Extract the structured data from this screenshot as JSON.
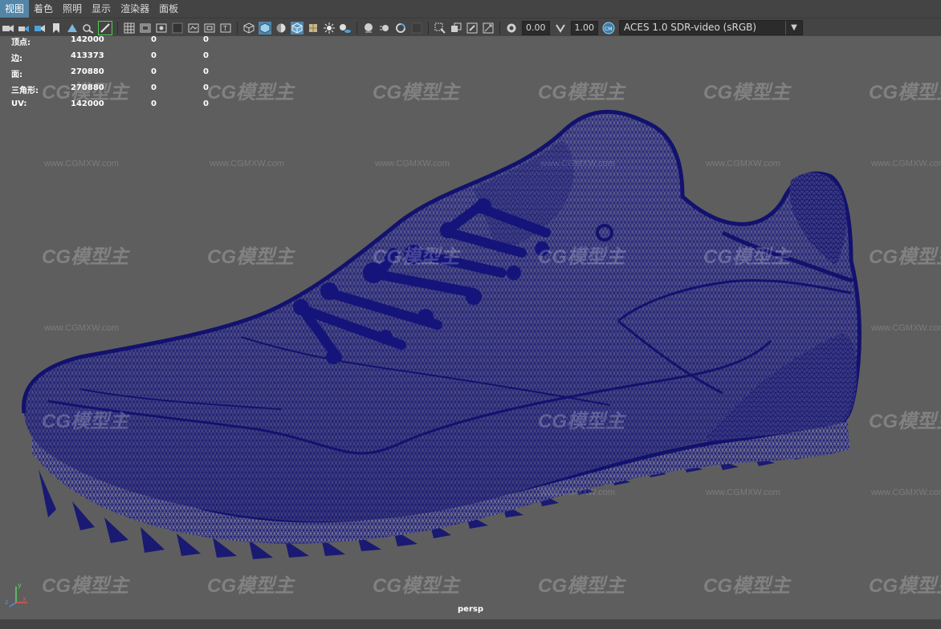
{
  "menu": {
    "items": [
      {
        "label": "视图",
        "active": true
      },
      {
        "label": "着色",
        "active": false
      },
      {
        "label": "照明",
        "active": false
      },
      {
        "label": "显示",
        "active": false
      },
      {
        "label": "渲染器",
        "active": false
      },
      {
        "label": "面板",
        "active": false
      }
    ]
  },
  "toolbar": {
    "gamma_value": "0.00",
    "exposure_value": "1.00",
    "color_space": "ACES 1.0 SDR-video (sRGB)"
  },
  "hud": {
    "rows": [
      {
        "label": "顶点:",
        "v1": "142000",
        "v2": "0",
        "v3": "0"
      },
      {
        "label": "边:",
        "v1": "413373",
        "v2": "0",
        "v3": "0"
      },
      {
        "label": "面:",
        "v1": "270880",
        "v2": "0",
        "v3": "0"
      },
      {
        "label": "三角形:",
        "v1": "270880",
        "v2": "0",
        "v3": "0"
      },
      {
        "label": "UV:",
        "v1": "142000",
        "v2": "0",
        "v3": "0"
      }
    ]
  },
  "viewport": {
    "camera_label": "persp",
    "mesh_color": "#1a1a7a",
    "background_color": "#5e5e5e"
  },
  "watermark": {
    "logo_text": "CG模型主",
    "url_text": "www.CGMXW.com"
  },
  "axis": {
    "x": "x",
    "y": "y",
    "z": "z"
  }
}
